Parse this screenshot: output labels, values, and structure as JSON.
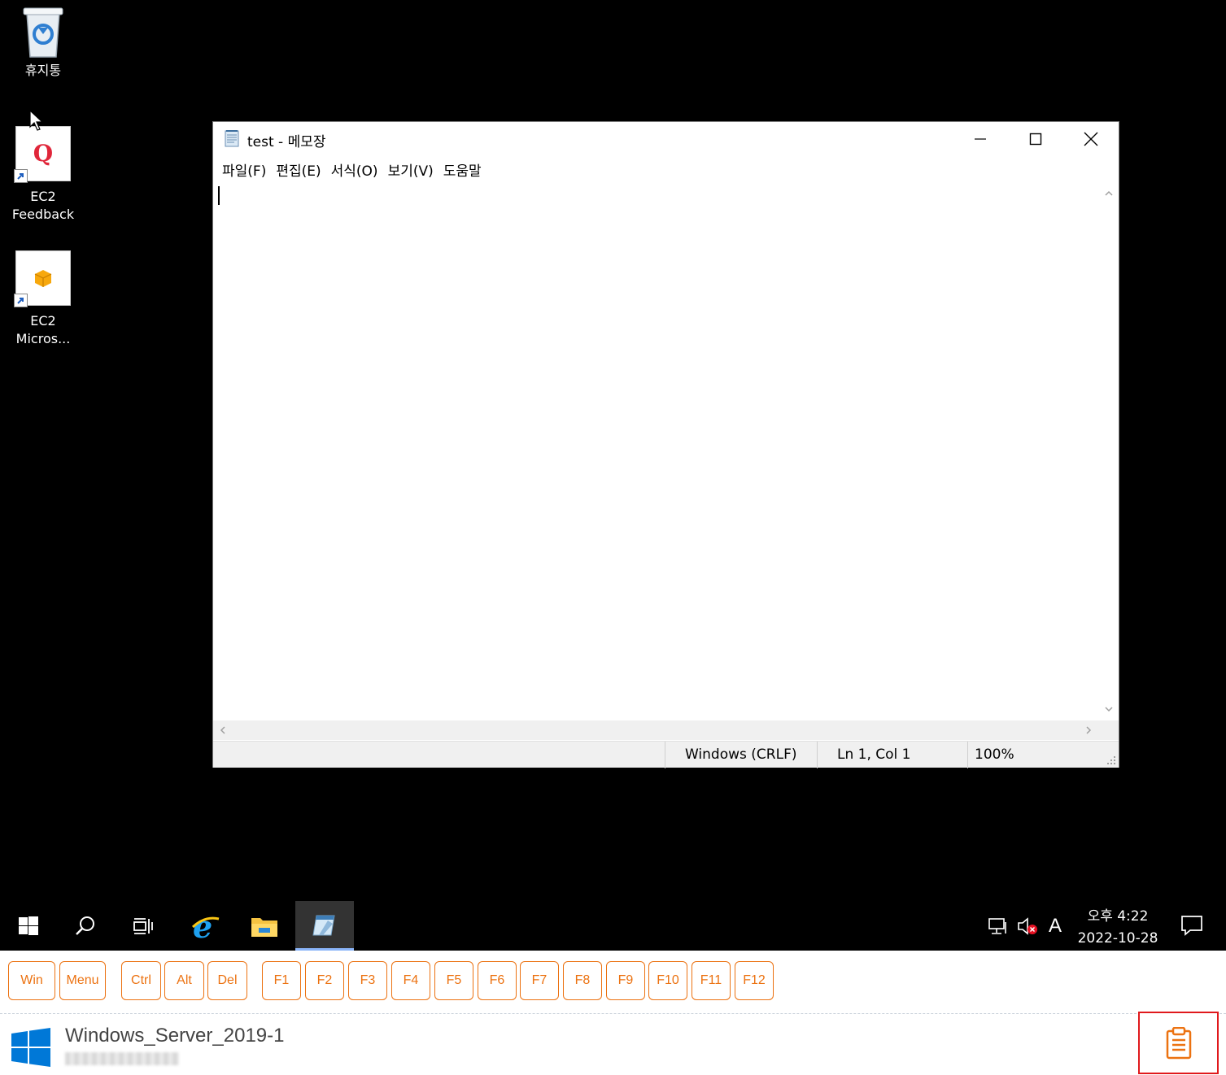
{
  "desktop": {
    "icons": [
      {
        "label": "휴지통",
        "icon": "recycle-bin-icon"
      },
      {
        "label": "EC2\nFeedback",
        "icon": "feedback-q-icon"
      },
      {
        "label": "EC2\nMicros...",
        "icon": "aws-box-icon"
      }
    ]
  },
  "notepad": {
    "title": "test - 메모장",
    "menu": [
      "파일(F)",
      "편집(E)",
      "서식(O)",
      "보기(V)",
      "도움말"
    ],
    "content": "",
    "status": {
      "encoding": "Windows (CRLF)",
      "position": "Ln 1, Col 1",
      "zoom": "100%"
    }
  },
  "taskbar": {
    "clock_time": "오후 4:22",
    "clock_date": "2022-10-28",
    "ime": "A"
  },
  "keys": [
    "Win",
    "Menu",
    "Ctrl",
    "Alt",
    "Del",
    "F1",
    "F2",
    "F3",
    "F4",
    "F5",
    "F6",
    "F7",
    "F8",
    "F9",
    "F10",
    "F11",
    "F12"
  ],
  "footer": {
    "instance_name": "Windows_Server_2019-1"
  },
  "colors": {
    "accent": "#ec7211",
    "highlight": "#e0191c",
    "windows_blue": "#0078d7"
  }
}
